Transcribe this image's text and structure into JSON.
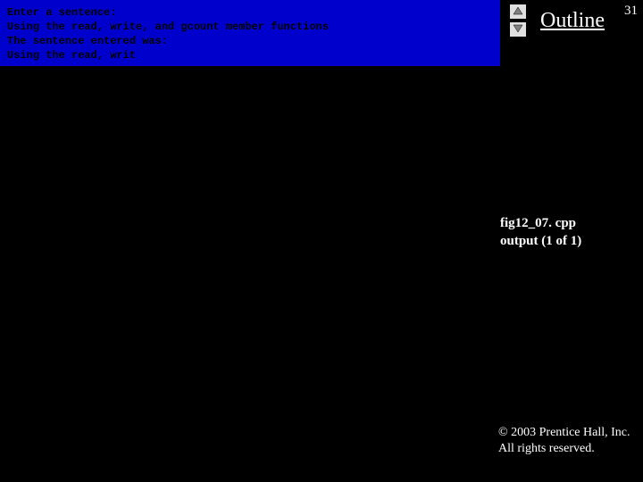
{
  "console": {
    "line1": "Enter a sentence:",
    "line2": "Using the read, write, and gcount member functions",
    "line3": "The sentence entered was:",
    "line4": "Using the read, writ"
  },
  "header": {
    "outline": "Outline",
    "page_number": "31"
  },
  "figure": {
    "filename": "fig12_07. cpp",
    "output_label": "output (1 of 1)"
  },
  "footer": {
    "copyright_line1": "© 2003 Prentice Hall, Inc.",
    "copyright_line2": "All rights reserved."
  }
}
